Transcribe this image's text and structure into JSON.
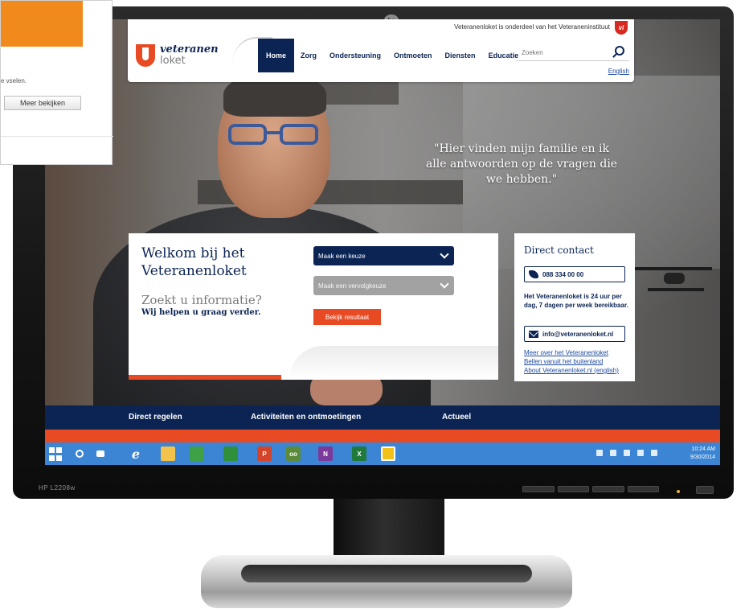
{
  "overlay": {
    "text": "e vselen.",
    "button": "Meer bekijken"
  },
  "monitor": {
    "model": "HP L2208w",
    "brand_logo": "hp"
  },
  "site": {
    "topline": "Veteranenloket is onderdeel van het Veteraneninstituut",
    "vi_badge": "vi",
    "logo_word1": "veteranen",
    "logo_word2": "loket",
    "nav": [
      {
        "label": "Home",
        "active": true
      },
      {
        "label": "Zorg"
      },
      {
        "label": "Ondersteuning"
      },
      {
        "label": "Ontmoeten"
      },
      {
        "label": "Diensten"
      },
      {
        "label": "Educatie"
      }
    ],
    "search_placeholder": "Zoeken",
    "english": "English"
  },
  "hero": {
    "quote": "\"Hier vinden mijn familie en ik alle antwoorden op de vragen die we hebben.\""
  },
  "welcome": {
    "title": "Welkom bij het Veteranenloket",
    "subtitle": "Zoekt u informatie?",
    "help": "Wij helpen u graag verder.",
    "select1": "Maak een keuze",
    "select2": "Maak een vervolgkeuze",
    "result_button": "Bekijk resultaat"
  },
  "contact": {
    "title": "Direct contact",
    "phone": "088 334 00 00",
    "info": "Het Veteranenloket is 24 uur per dag, 7 dagen per week bereikbaar.",
    "email": "info@veteranenloket.nl",
    "links": [
      "Meer over het Veteranenloket",
      "Bellen vanuit het buitenland",
      "About Veteranenloket.nl (english)"
    ]
  },
  "footer": {
    "items": [
      "Direct regelen",
      "Activiteiten en ontmoetingen",
      "Actueel"
    ]
  },
  "taskbar": {
    "icons": [
      "windows-icon",
      "search-icon",
      "task-view-icon",
      "ie-icon",
      "folder-icon",
      "store-icon",
      "sway-icon",
      "powerpoint-icon",
      "tripadvisor-icon",
      "onenote-icon",
      "excel-icon",
      "sticky-icon"
    ],
    "time": "10:24 AM",
    "date": "9/30/2014"
  },
  "colors": {
    "navy": "#0b2454",
    "orange": "#e84a24",
    "taskbar": "#3b85d4"
  }
}
